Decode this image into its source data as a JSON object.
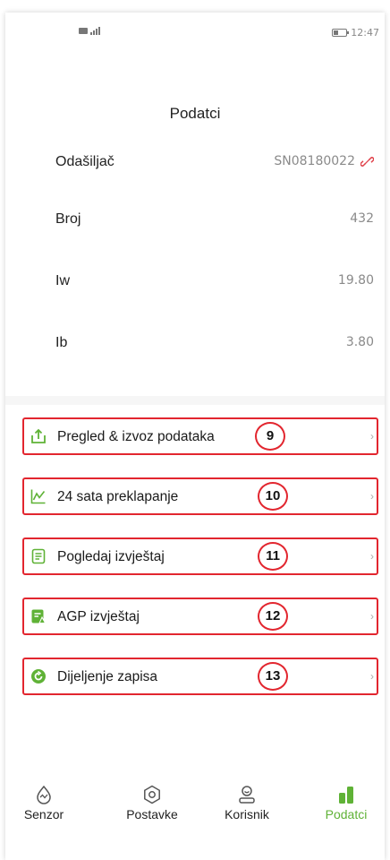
{
  "status_bar": {
    "time": "12:47"
  },
  "header": {
    "title": "Podatci"
  },
  "info": [
    {
      "label": "Odašiljač",
      "value": "SN08180022"
    },
    {
      "label": "Broj",
      "value": "432"
    },
    {
      "label": "Iw",
      "value": "19.80"
    },
    {
      "label": "Ib",
      "value": "3.80"
    }
  ],
  "menu": [
    {
      "label": "Pregled & izvoz podataka",
      "badge": "9",
      "icon": "export-upload-icon"
    },
    {
      "label": "24 sata preklapanje",
      "badge": "10",
      "icon": "line-chart-icon"
    },
    {
      "label": "Pogledaj izvještaj",
      "badge": "11",
      "icon": "report-document-icon"
    },
    {
      "label": "AGP izvještaj",
      "badge": "12",
      "icon": "agp-report-icon"
    },
    {
      "label": "Dijeljenje zapisa",
      "badge": "13",
      "icon": "share-refresh-icon"
    }
  ],
  "bottom_nav": [
    {
      "label": "Senzor",
      "icon": "sensor-icon"
    },
    {
      "label": "Postavke",
      "icon": "settings-icon"
    },
    {
      "label": "Korisnik",
      "icon": "user-icon"
    },
    {
      "label": "Podatci",
      "icon": "data-bars-icon",
      "active": true
    }
  ],
  "colors": {
    "accent": "#5fb236",
    "highlight": "#e2262f",
    "unlink": "#e0414a"
  }
}
